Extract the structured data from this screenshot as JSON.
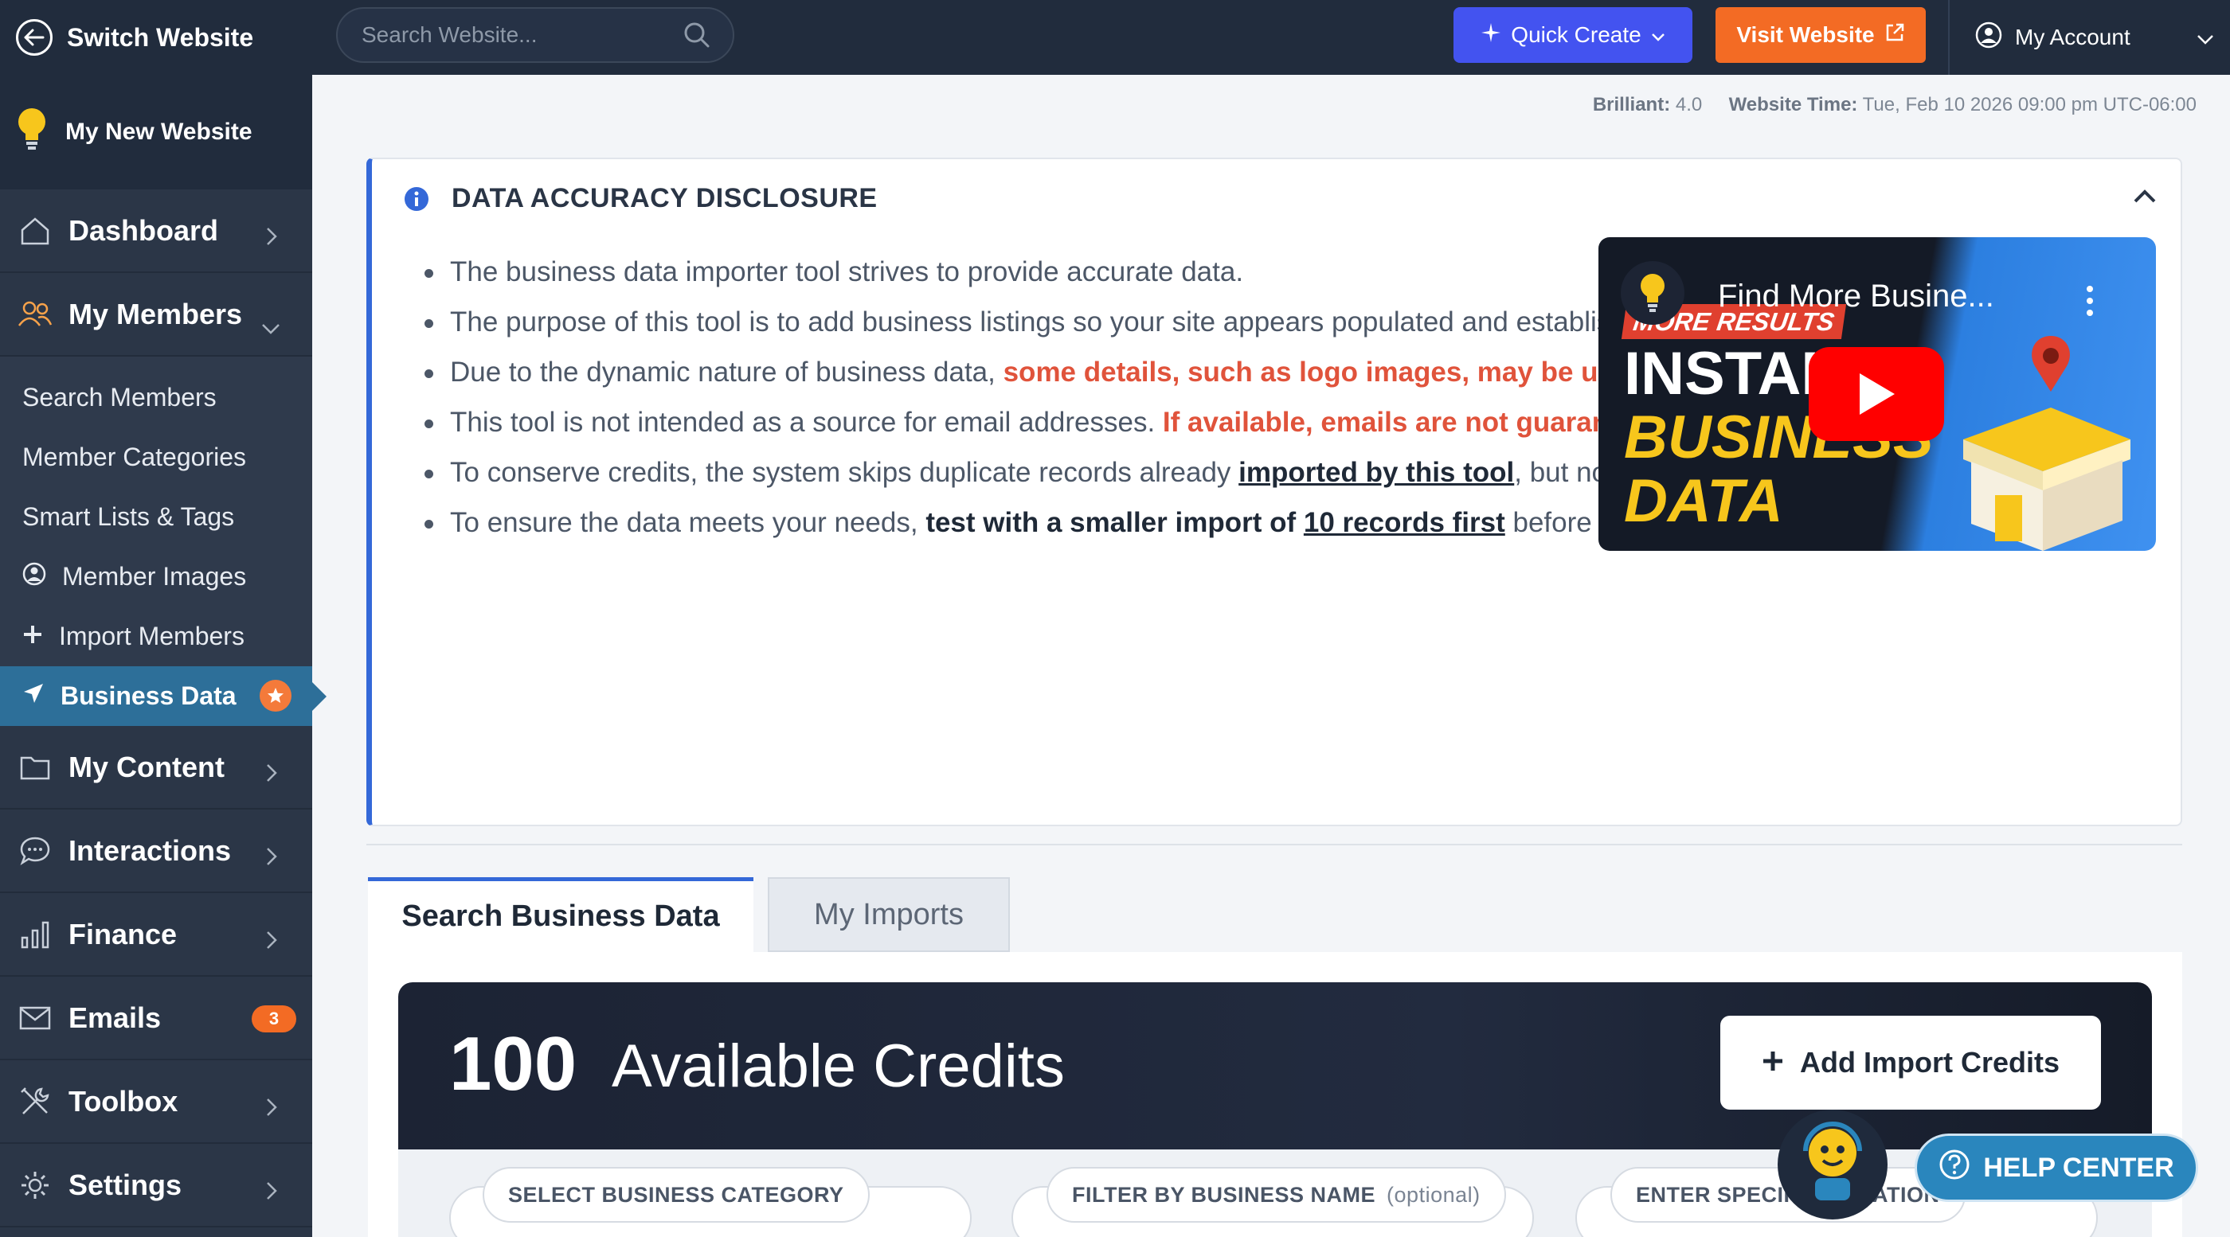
{
  "topbar": {
    "switch_label": "Switch Website",
    "search_placeholder": "Search Website...",
    "quick_create": "Quick Create",
    "visit_website": "Visit Website",
    "my_account": "My Account"
  },
  "meta": {
    "brilliant_label": "Brilliant:",
    "brilliant_version": "4.0",
    "time_label": "Website Time:",
    "time_value": "Tue, Feb 10 2026 09:00 pm UTC-06:00"
  },
  "sidebar": {
    "site_name": "My New Website",
    "items": [
      {
        "label": "Dashboard",
        "icon": "home-icon"
      },
      {
        "label": "My Members",
        "icon": "users-icon"
      }
    ],
    "submenu": [
      {
        "label": "Search Members"
      },
      {
        "label": "Member Categories"
      },
      {
        "label": "Smart Lists & Tags"
      },
      {
        "label": "Member Images"
      },
      {
        "label": "Import Members"
      },
      {
        "label": "Business Data"
      }
    ],
    "items_after": [
      {
        "label": "My Content"
      },
      {
        "label": "Interactions"
      },
      {
        "label": "Finance"
      },
      {
        "label": "Emails",
        "badge": "3"
      },
      {
        "label": "Toolbox"
      },
      {
        "label": "Settings"
      }
    ]
  },
  "disclosure": {
    "title": "DATA ACCURACY DISCLOSURE",
    "b1": "The business data importer tool strives to provide accurate data.",
    "b2": "The purpose of this tool is to add business listings so your site appears populated and established.",
    "b3_a": "Due to the dynamic nature of business data, ",
    "b3_red": "some details, such as logo images, may be unavailable",
    "b3_b": ".",
    "b4_a": "This tool is not intended as a source for email addresses. ",
    "b4_red": "If available, emails are not guaranteed to work.",
    "b5_a": "To conserve credits, the system skips duplicate records already ",
    "b5_link": "imported by this tool",
    "b5_b": ", but not from other sources.",
    "b6_a": "To ensure the data meets your needs, ",
    "b6_strong": "test with a smaller import of ",
    "b6_link": "10 records first",
    "b6_b": " before initiating larger imports.",
    "video": {
      "title": "Find More Busine...",
      "more": "MORE RESULTS",
      "line1": "INSTAN",
      "line2": "BUSINESS",
      "line3": "DATA"
    }
  },
  "tabs": [
    "Search Business Data",
    "My Imports"
  ],
  "credits": {
    "count": "100",
    "label": "Available Credits",
    "add_button": "Add Import Credits"
  },
  "filters": {
    "category": "SELECT BUSINESS CATEGORY",
    "name": "FILTER BY BUSINESS NAME",
    "name_optional": "(optional)",
    "location": "ENTER SPECIFIC LOCATION"
  },
  "help_center": "HELP CENTER",
  "colors": {
    "accent_blue": "#3468d8",
    "quick_create": "#4353f0",
    "visit_orange": "#f36b24",
    "warning_red": "#e0533b",
    "active_nav": "#2d6f99"
  }
}
